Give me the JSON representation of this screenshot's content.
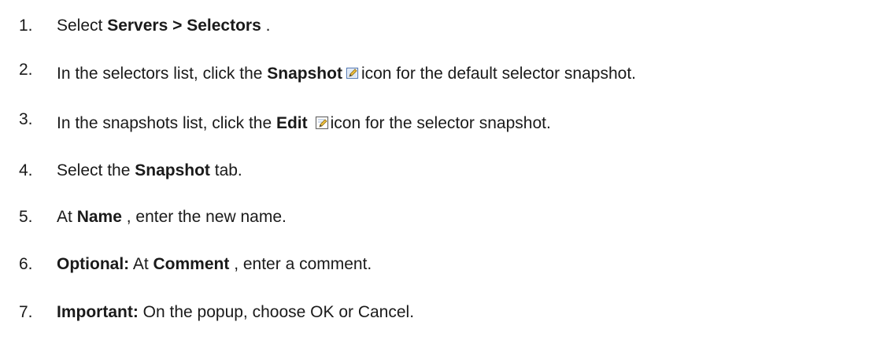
{
  "steps": [
    {
      "number": "1.",
      "parts": [
        "Select ",
        "Servers > Selectors",
        " ."
      ]
    },
    {
      "number": "2.",
      "parts": [
        "In the selectors list, click the ",
        "Snapshot",
        "icon for the default selector snapshot."
      ],
      "icon": "snapshot-icon"
    },
    {
      "number": "3.",
      "parts": [
        "In the snapshots list, click the ",
        "Edit",
        "icon for the selector snapshot."
      ],
      "icon": "edit-icon"
    },
    {
      "number": "4.",
      "parts": [
        "Select the ",
        "Snapshot",
        " tab."
      ]
    },
    {
      "number": "5.",
      "parts": [
        "At ",
        "Name",
        " , enter the new name."
      ]
    },
    {
      "number": "6.",
      "parts": [
        "Optional:",
        " At ",
        "Comment",
        " , enter a comment."
      ]
    },
    {
      "number": "7.",
      "parts": [
        "Important:",
        " On the popup, choose OK or Cancel."
      ]
    }
  ]
}
